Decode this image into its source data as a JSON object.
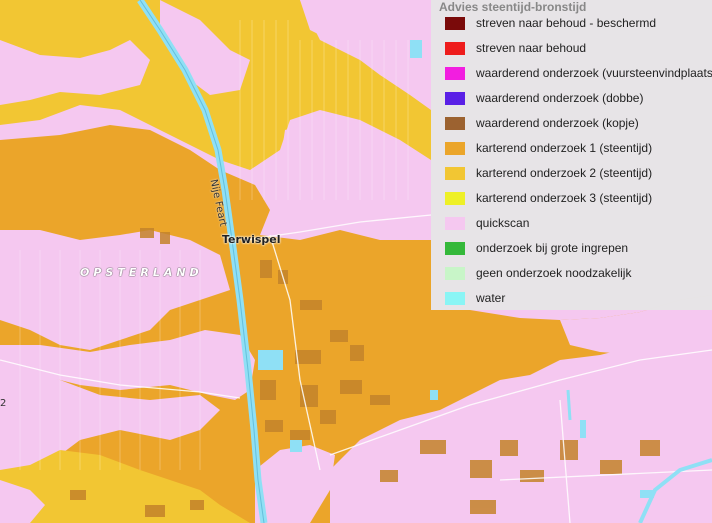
{
  "map": {
    "labels": {
      "town": "Terwispel",
      "region": "OPSTERLAND",
      "canal": "Nije Feart",
      "left_edge": "2"
    },
    "colors": {
      "quickscan": "#f5c8f0",
      "karterend_1": "#eba52a",
      "karterend_2": "#f2c633",
      "karterend_3": "#eef027",
      "water": "#8fe0f5",
      "building": "#c4832a"
    }
  },
  "legend": {
    "title": "Advies steentijd-bronstijd",
    "items": [
      {
        "label": "streven naar behoud - beschermd",
        "color": "#7a0a0a"
      },
      {
        "label": "streven naar behoud",
        "color": "#ee1c1c"
      },
      {
        "label": "waarderend onderzoek (vuursteenvindplaats)",
        "color": "#f21ee0"
      },
      {
        "label": "waarderend onderzoek (dobbe)",
        "color": "#5a20e6"
      },
      {
        "label": "waarderend onderzoek (kopje)",
        "color": "#9c6230"
      },
      {
        "label": "karterend onderzoek 1 (steentijd)",
        "color": "#eba52a"
      },
      {
        "label": "karterend onderzoek 2 (steentijd)",
        "color": "#f2c633"
      },
      {
        "label": "karterend onderzoek 3 (steentijd)",
        "color": "#eef027"
      },
      {
        "label": "quickscan",
        "color": "#f5c8f0"
      },
      {
        "label": "onderzoek bij grote ingrepen",
        "color": "#35b83a"
      },
      {
        "label": "geen onderzoek noodzakelijk",
        "color": "#c8f5c8"
      },
      {
        "label": "water",
        "color": "#8af5f5"
      }
    ]
  }
}
